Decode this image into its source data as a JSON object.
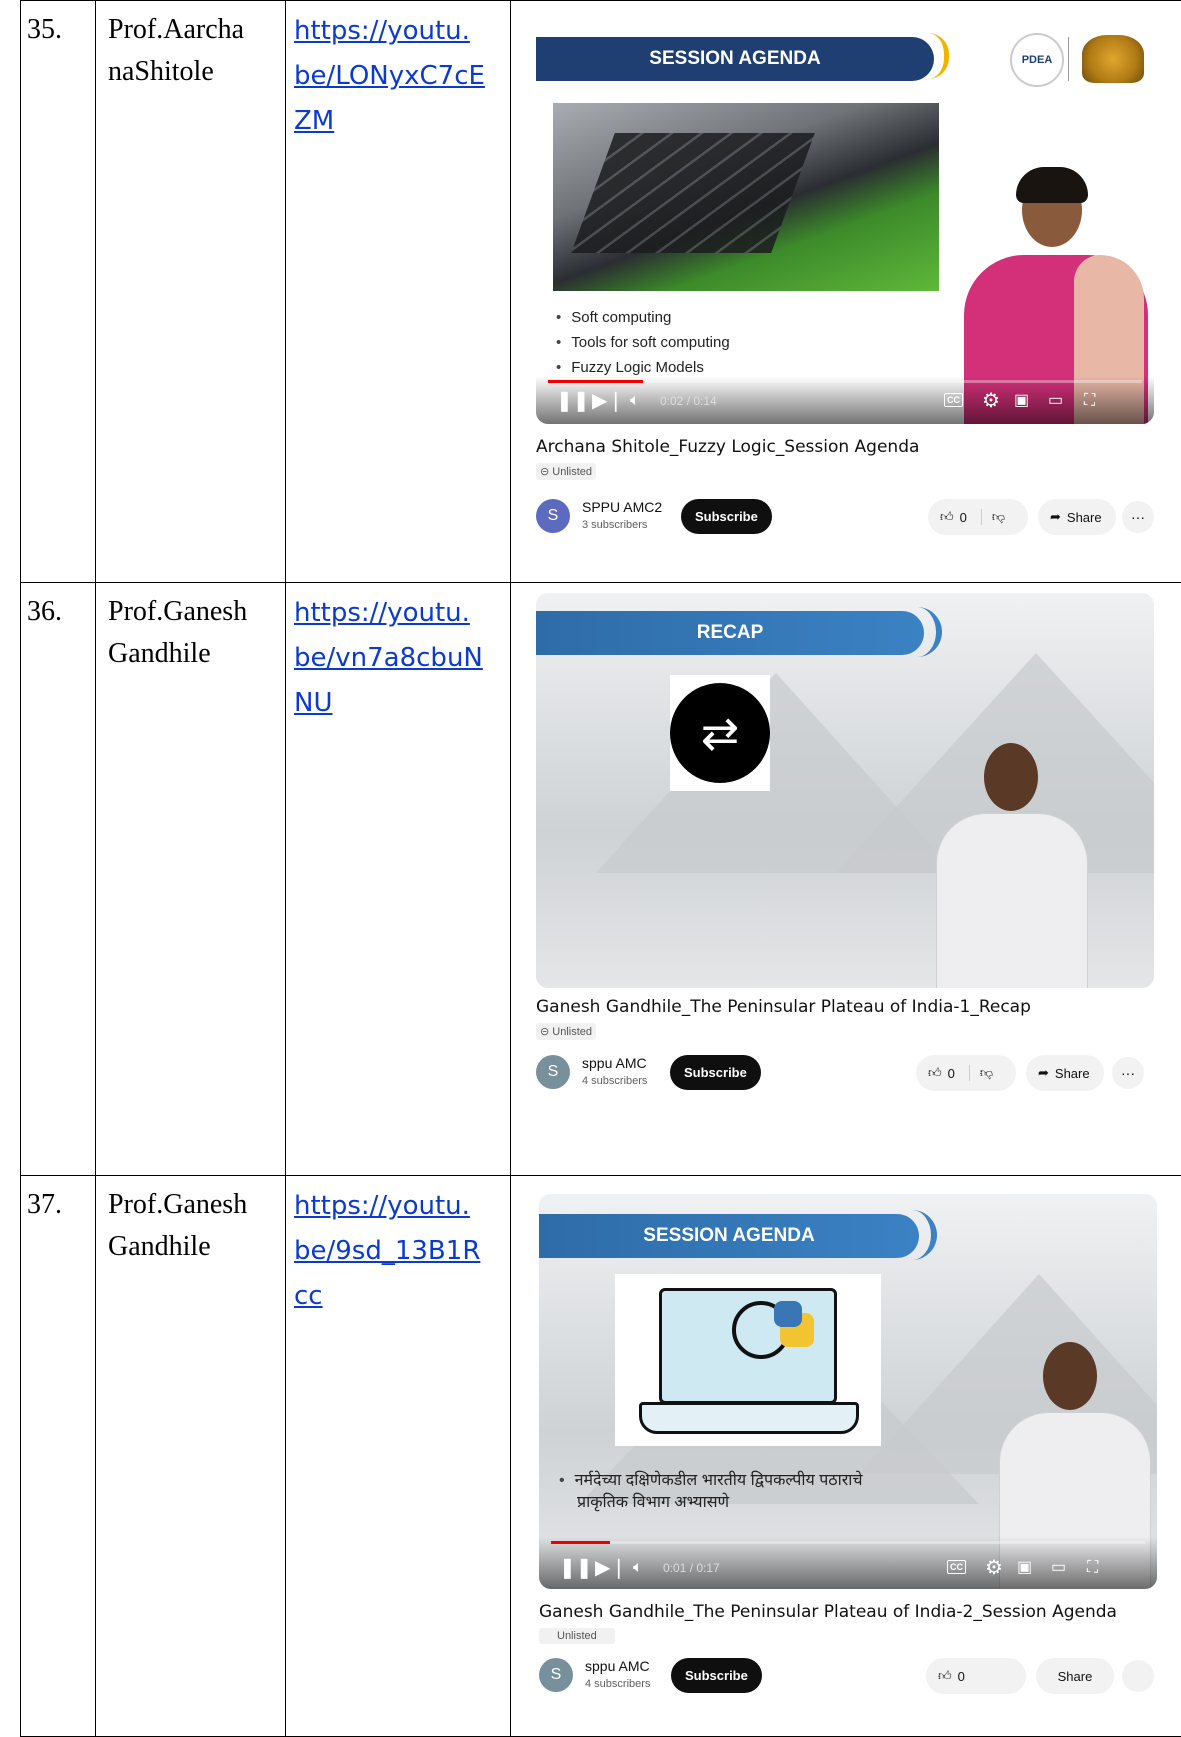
{
  "rows": [
    {
      "num": "35.",
      "name": "Prof.Aarchana Shitole",
      "name_line1": "Prof.Aarcha",
      "name_line2": "naShitole",
      "link_lines": [
        "https://youtu.",
        "be/LONyxC7cE",
        "ZM"
      ],
      "video": {
        "banner": "SESSION AGENDA",
        "logo_text": "PDEA",
        "bullets": [
          "Soft computing",
          "Tools for soft computing",
          "Fuzzy Logic Models"
        ],
        "time": "0:02 / 0:14",
        "progress": 0.16,
        "cc": "CC",
        "title": "Archana Shitole_Fuzzy Logic_Session Agenda",
        "unlisted": "Unlisted",
        "avatar_letter": "S",
        "channel": "SPPU AMC2",
        "subscribers": "3 subscribers",
        "subscribe": "Subscribe",
        "likes": "0",
        "share": "Share",
        "more": "···"
      }
    },
    {
      "num": "36.",
      "name": "Prof.Ganesh Gandhile",
      "name_line1": "Prof.Ganesh",
      "name_line2": "Gandhile",
      "link_lines": [
        "https://youtu.",
        "be/vn7a8cbuN",
        "NU"
      ],
      "video": {
        "banner": "RECAP",
        "title": "Ganesh Gandhile_The Peninsular Plateau of India-1_Recap",
        "unlisted": "Unlisted",
        "avatar_letter": "S",
        "channel": "sppu AMC",
        "subscribers": "4 subscribers",
        "subscribe": "Subscribe",
        "likes": "0",
        "share": "Share",
        "more": "···"
      }
    },
    {
      "num": "37.",
      "name": "Prof.Ganesh Gandhile",
      "name_line1": "Prof.Ganesh",
      "name_line2": "Gandhile",
      "link_lines": [
        "https://youtu.",
        "be/9sd_13B1R",
        "cc"
      ],
      "video": {
        "banner": "SESSION AGENDA",
        "bullet": "नर्मदेच्या दक्षिणेकडील भारतीय द्विपकल्पीय पठाराचे प्राकृतिक विभाग अभ्यासणे",
        "bullet_l1": "नर्मदेच्या दक्षिणेकडील भारतीय द्विपकल्पीय पठाराचे",
        "bullet_l2": "प्राकृतिक विभाग अभ्यासणे",
        "time": "0:01 / 0:17",
        "progress": 0.1,
        "cc": "CC",
        "title": "Ganesh Gandhile_The Peninsular Plateau of India-2_Session Agenda",
        "unlisted": "Unlisted",
        "avatar_letter": "S",
        "channel": "sppu AMC",
        "subscribers": "4 subscribers",
        "subscribe": "Subscribe",
        "likes": "0",
        "share": "Share"
      }
    }
  ],
  "colors": {
    "link": "#0b3ad0",
    "banner_dark": "#1f3f73",
    "banner_light": "#3b82c4",
    "progress": "#ee0000",
    "pink_saree": "#d4307a"
  },
  "icons": [
    "play-pause-icon",
    "next-icon",
    "volume-icon",
    "settings-icon",
    "miniplayer-icon",
    "theater-icon",
    "fullscreen-icon",
    "like-icon",
    "dislike-icon",
    "share-icon",
    "more-icon",
    "repeat-icon",
    "laptop-chart-icon"
  ]
}
